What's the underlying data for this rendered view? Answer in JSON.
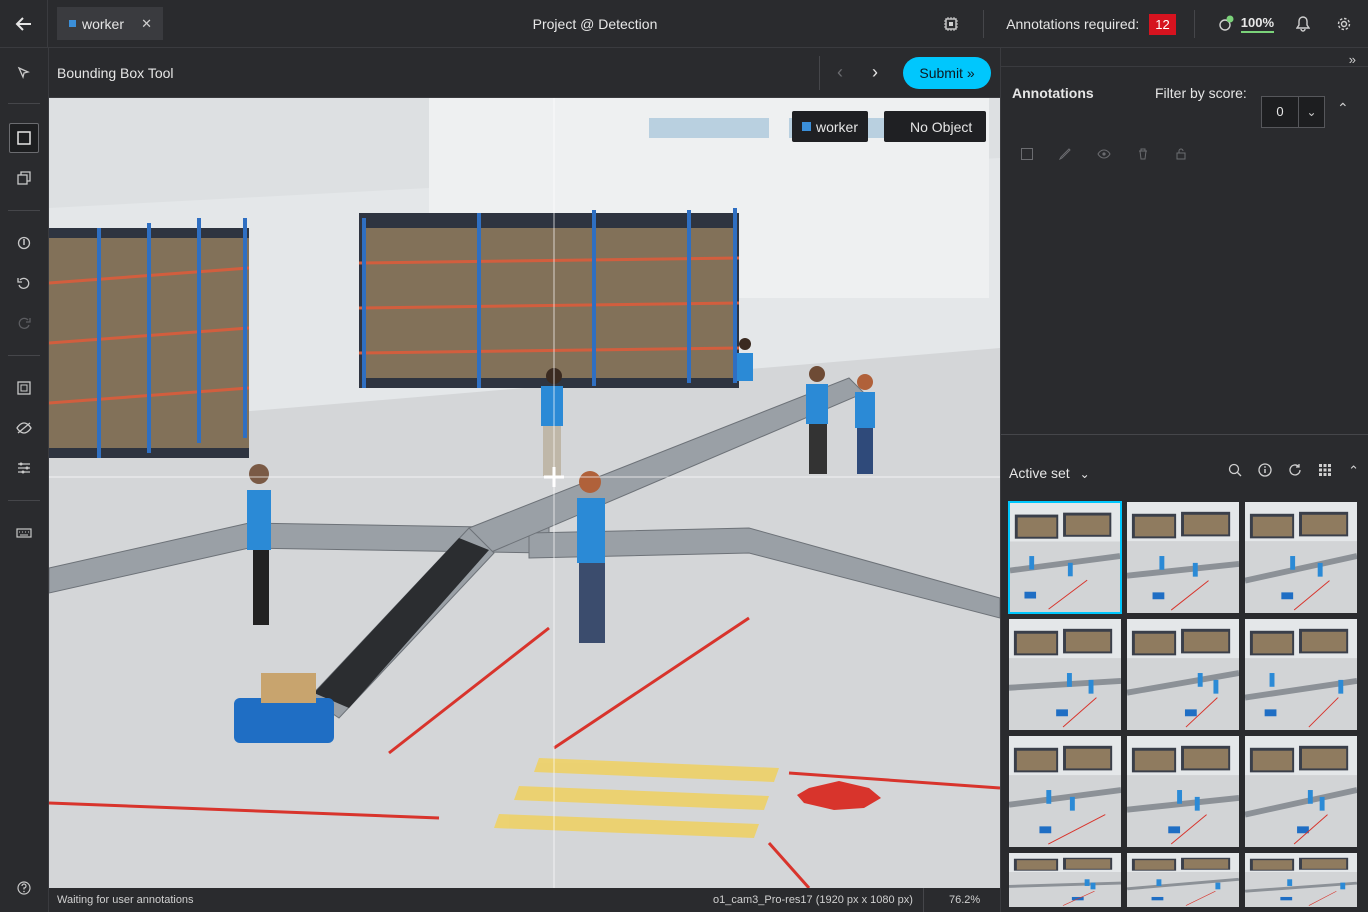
{
  "topbar": {
    "label_tab": "worker",
    "project_title": "Project @ Detection",
    "annotations_required_label": "Annotations required:",
    "annotations_required_count": "12",
    "completion": "100%"
  },
  "toolbar": {
    "tool_name": "Bounding Box Tool",
    "submit_label": "Submit »"
  },
  "canvas": {
    "labels": [
      {
        "name": "worker",
        "color": "#3b8fd9"
      },
      {
        "name": "No Object"
      }
    ]
  },
  "statusbar": {
    "status": "Waiting for user annotations",
    "media_info": "o1_cam3_Pro-res17 (1920 px x 1080 px)",
    "zoom": "76.2%"
  },
  "annotations_panel": {
    "title": "Annotations",
    "filter_label": "Filter by score:",
    "filter_value": "0"
  },
  "dataset_panel": {
    "title": "Active set"
  },
  "colors": {
    "accent": "#00c7fd",
    "badge": "#d6131f",
    "label_worker": "#3b8fd9"
  }
}
